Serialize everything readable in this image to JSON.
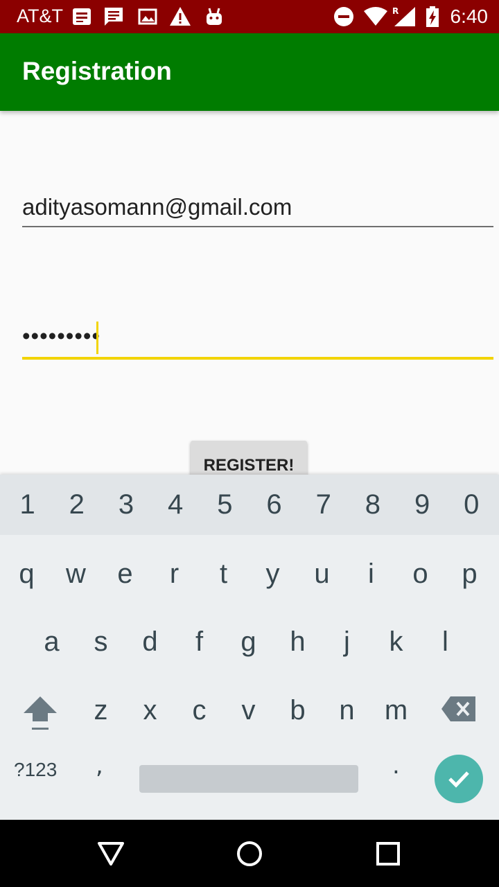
{
  "status_bar": {
    "carrier": "AT&T",
    "time": "6:40",
    "notification_icons": [
      "sim-card-icon",
      "message-icon",
      "image-icon",
      "warning-icon",
      "android-icon"
    ],
    "system_icons": [
      "do-not-disturb-icon",
      "wifi-icon",
      "signal-roaming-icon",
      "battery-charging-icon"
    ],
    "background_color": "#8b0000"
  },
  "app_bar": {
    "title": "Registration",
    "background_color": "#007c00"
  },
  "form": {
    "email_value": "adityasomann@gmail.com",
    "password_value": "•••••••••",
    "accent_color": "#f2d400",
    "register_label": "REGISTER!"
  },
  "keyboard": {
    "number_row": [
      "1",
      "2",
      "3",
      "4",
      "5",
      "6",
      "7",
      "8",
      "9",
      "0"
    ],
    "row1": [
      "q",
      "w",
      "e",
      "r",
      "t",
      "y",
      "u",
      "i",
      "o",
      "p"
    ],
    "row2": [
      "a",
      "s",
      "d",
      "f",
      "g",
      "h",
      "j",
      "k",
      "l"
    ],
    "row3": [
      "z",
      "x",
      "c",
      "v",
      "b",
      "n",
      "m"
    ],
    "symbols_label": "?123",
    "comma": ",",
    "period": ".",
    "enter_color": "#4db6ac"
  },
  "nav_bar": {
    "icons": [
      "back-icon",
      "home-icon",
      "recents-icon"
    ]
  }
}
